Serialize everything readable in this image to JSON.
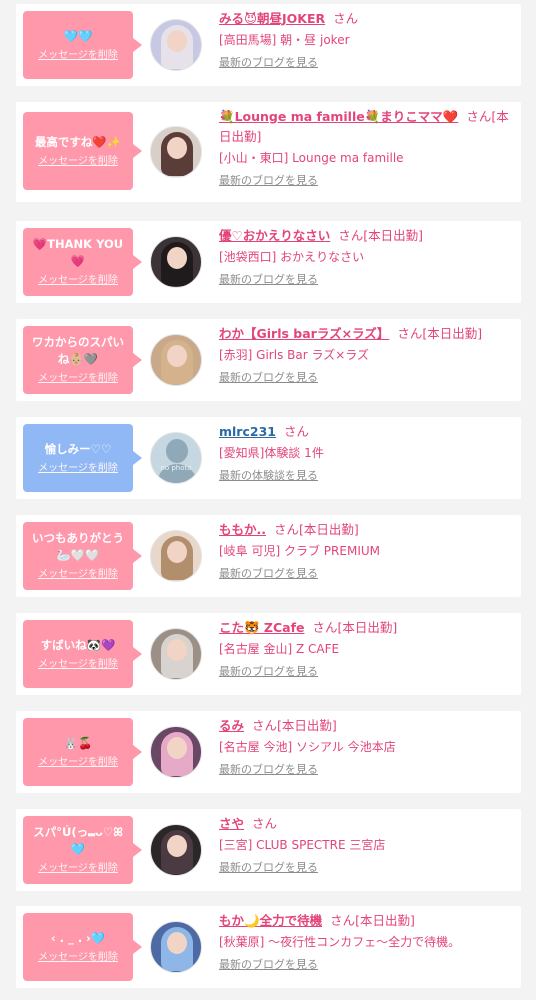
{
  "messages": [
    {
      "message": "🩵🩵",
      "delete_label": "メッセージを削除",
      "bubble_color": "pink",
      "name": "みる😈朝昼JOKER",
      "suffix": "さん",
      "shop": "[高田馬場] 朝・昼 joker",
      "link_label": "最新のブログを見る",
      "avatar_color": "#b5b8d8"
    },
    {
      "message": "最高ですね❤️✨",
      "delete_label": "メッセージを削除",
      "bubble_color": "pink",
      "name": "💐Lounge ma famille💐まりこママ❤️",
      "suffix": "さん[本日出勤]",
      "shop": "[小山・東口] Lounge ma famille",
      "link_label": "最新のブログを見る",
      "avatar_color": "#6a4c49"
    },
    {
      "message": "💗THANK YOU💗",
      "delete_label": "メッセージを削除",
      "bubble_color": "pink",
      "name": "優♡おかえりなさい",
      "suffix": "さん[本日出勤]",
      "shop": "[池袋西口] おかえりなさい",
      "link_label": "最新のブログを見る",
      "avatar_color": "#2f2a2c"
    },
    {
      "message": "ワカからのスパいね👶🏼🩶",
      "delete_label": "メッセージを削除",
      "bubble_color": "pink",
      "name": "わか【Girls barラズ×ラズ】",
      "suffix": "さん[本日出勤]",
      "shop": "[赤羽] Girls Bar ラズ×ラズ",
      "link_label": "最新のブログを見る",
      "avatar_color": "#c2a078"
    },
    {
      "message": "愉しみー♡♡",
      "delete_label": "メッセージを削除",
      "bubble_color": "blue",
      "name": "mlrc231",
      "suffix": "さん",
      "shop": "[愛知県]体験談 1件",
      "link_label": "最新の体験談を見る",
      "avatar_color": "#b9cdd8",
      "no_photo": "no photo"
    },
    {
      "message": "いつもありがとう🦢🤍🤍",
      "delete_label": "メッセージを削除",
      "bubble_color": "pink",
      "name": "ももか..",
      "suffix": "さん[本日出勤]",
      "shop": "[岐阜 可児] クラブ PREMIUM",
      "link_label": "最新のブログを見る",
      "avatar_color": "#a98463"
    },
    {
      "message": "すばいね🐼💜",
      "delete_label": "メッセージを削除",
      "bubble_color": "pink",
      "name": "こた🐯 ZCafe",
      "suffix": "さん[本日出勤]",
      "shop": "[名古屋 金山] Z CAFE",
      "link_label": "最新のブログを見る",
      "avatar_color": "#8a7b72"
    },
    {
      "message": "🐰🍒",
      "delete_label": "メッセージを削除",
      "bubble_color": "pink",
      "name": "るみ",
      "suffix": "さん[本日出勤]",
      "shop": "[名古屋 今池] ソシアル 今池本店",
      "link_label": "最新のブログを見る",
      "avatar_color": "#5a3f5a"
    },
    {
      "message": "スパ°Ú(っ⑉ᴗ♡ꕤ🩵",
      "delete_label": "メッセージを削除",
      "bubble_color": "pink",
      "name": "さや",
      "suffix": "さん",
      "shop": "[三宮] CLUB SPECTRE 三宮店",
      "link_label": "最新のブログを見る",
      "avatar_color": "#3a3235"
    },
    {
      "message": "‹ . _ . ›🩵",
      "delete_label": "メッセージを削除",
      "bubble_color": "pink",
      "name": "もか🌙全力で待機",
      "suffix": "さん[本日出勤]",
      "shop": "[秋葉原] 〜夜行性コンカフェ〜全力で待機。",
      "link_label": "最新のブログを見る",
      "avatar_color": "#6f8ec6"
    }
  ]
}
